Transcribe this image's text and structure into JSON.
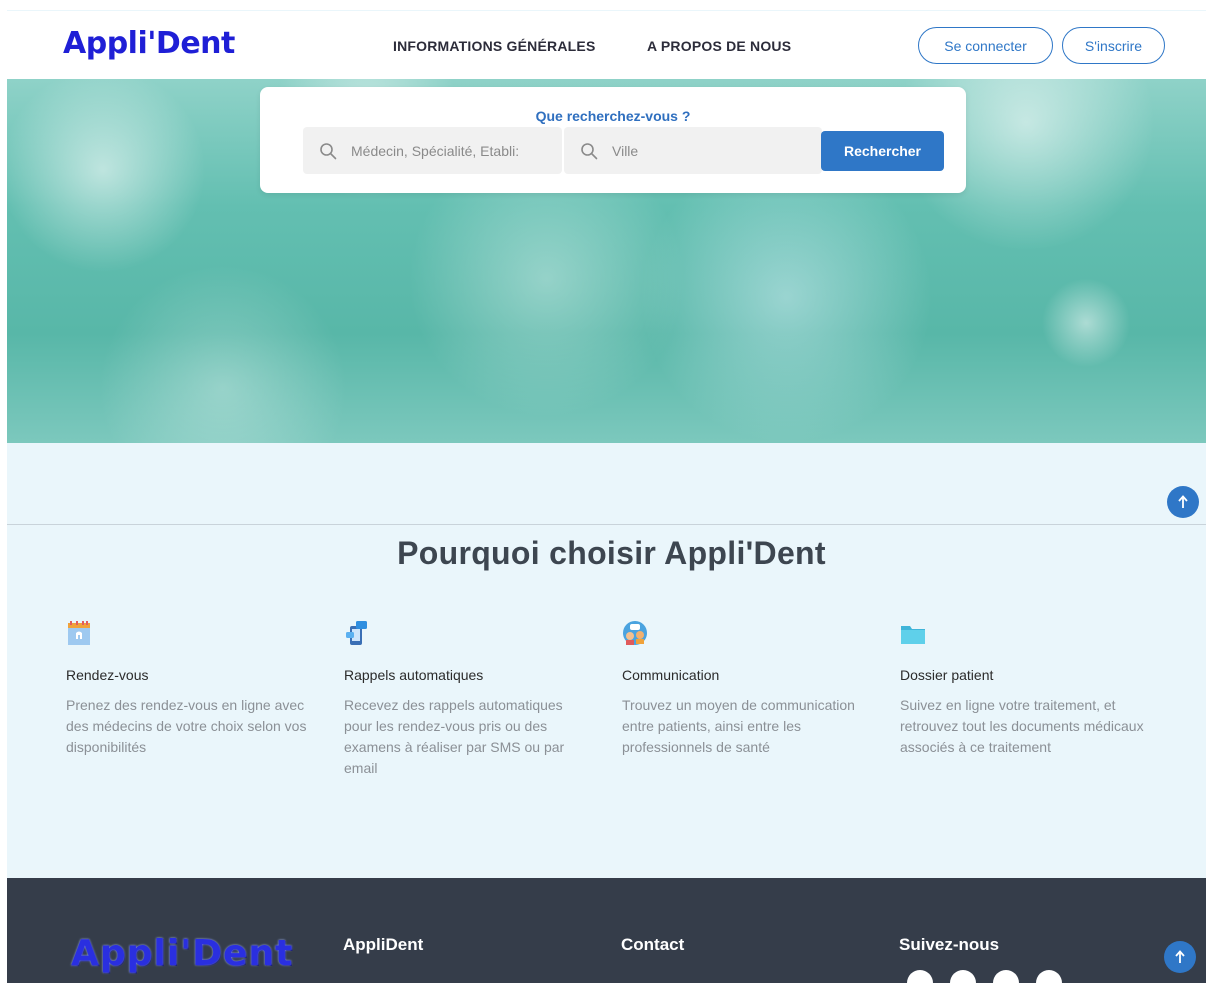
{
  "header": {
    "logo": "Appli'Dent",
    "nav": [
      "INFORMATIONS GÉNÉRALES",
      "A PROPOS DE NOUS"
    ],
    "login_label": "Se connecter",
    "signup_label": "S'inscrire"
  },
  "search": {
    "title": "Que recherchez-vous ?",
    "what_placeholder": "Médecin, Spécialité, Etabli:",
    "city_placeholder": "Ville",
    "button_label": "Rechercher"
  },
  "why": {
    "title": "Pourquoi choisir Appli'Dent",
    "features": [
      {
        "icon": "calendar-icon",
        "title": "Rendez-vous",
        "desc": "Prenez des rendez-vous en ligne avec des médecins de votre choix selon vos disponibilités"
      },
      {
        "icon": "phone-reminder-icon",
        "title": "Rappels automatiques",
        "desc": "Recevez des rappels automatiques pour les rendez-vous pris ou des examens à réaliser par SMS ou par email"
      },
      {
        "icon": "chat-people-icon",
        "title": "Communication",
        "desc": "Trouvez un moyen de communication entre patients, ainsi entre les professionnels de santé"
      },
      {
        "icon": "folder-icon",
        "title": "Dossier patient",
        "desc": "Suivez en ligne votre traitement, et retrouvez tout les documents médicaux associés à ce traitement"
      }
    ]
  },
  "footer": {
    "logo": "Appli'Dent",
    "col1_title": "AppliDent",
    "col2_title": "Contact",
    "col3_title": "Suivez-nous"
  },
  "colors": {
    "brand_blue": "#1f1fd6",
    "accent": "#2f77c7",
    "footer_bg": "#353d4a"
  }
}
